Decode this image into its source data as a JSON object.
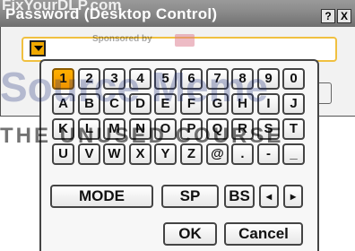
{
  "window": {
    "title": "Password (Desktop Control)",
    "help_label": "?",
    "close_label": "X"
  },
  "password": {
    "value": ""
  },
  "keyboard": {
    "row1": [
      "1",
      "2",
      "3",
      "4",
      "5",
      "6",
      "7",
      "8",
      "9",
      "0"
    ],
    "row2": [
      "A",
      "B",
      "C",
      "D",
      "E",
      "F",
      "G",
      "H",
      "I",
      "J"
    ],
    "row3": [
      "K",
      "L",
      "M",
      "N",
      "O",
      "P",
      "Q",
      "R",
      "S",
      "T"
    ],
    "row4": [
      "U",
      "V",
      "W",
      "X",
      "Y",
      "Z",
      "@",
      ".",
      "-",
      "_"
    ],
    "selected": "1",
    "mode_label": "MODE",
    "space_label": "SP",
    "backspace_label": "BS",
    "left_label": "◂",
    "right_label": "▸",
    "ok_label": "OK",
    "cancel_label": "Cancel"
  },
  "watermark": {
    "line1": "FixYourDLP.com",
    "line2": "Source Meme",
    "line3": "THE UNUSED COURSE",
    "sponsor": "Sponsored by"
  },
  "colors": {
    "titlebar": "#8a8a8a",
    "selected_key": "#f0a800",
    "input_border": "#f0c040"
  }
}
